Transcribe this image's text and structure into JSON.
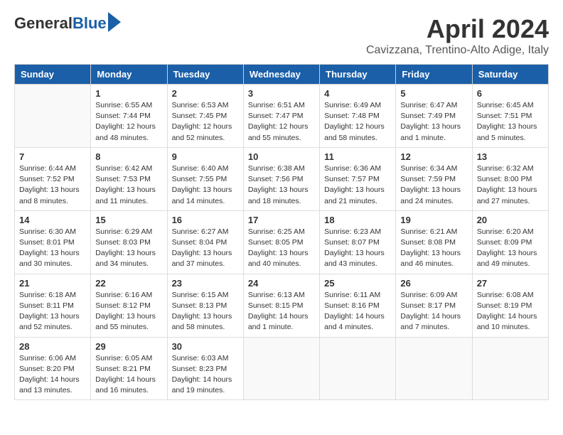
{
  "header": {
    "logo_general": "General",
    "logo_blue": "Blue",
    "title": "April 2024",
    "subtitle": "Cavizzana, Trentino-Alto Adige, Italy"
  },
  "weekdays": [
    "Sunday",
    "Monday",
    "Tuesday",
    "Wednesday",
    "Thursday",
    "Friday",
    "Saturday"
  ],
  "weeks": [
    [
      {
        "day": "",
        "info": ""
      },
      {
        "day": "1",
        "info": "Sunrise: 6:55 AM\nSunset: 7:44 PM\nDaylight: 12 hours\nand 48 minutes."
      },
      {
        "day": "2",
        "info": "Sunrise: 6:53 AM\nSunset: 7:45 PM\nDaylight: 12 hours\nand 52 minutes."
      },
      {
        "day": "3",
        "info": "Sunrise: 6:51 AM\nSunset: 7:47 PM\nDaylight: 12 hours\nand 55 minutes."
      },
      {
        "day": "4",
        "info": "Sunrise: 6:49 AM\nSunset: 7:48 PM\nDaylight: 12 hours\nand 58 minutes."
      },
      {
        "day": "5",
        "info": "Sunrise: 6:47 AM\nSunset: 7:49 PM\nDaylight: 13 hours\nand 1 minute."
      },
      {
        "day": "6",
        "info": "Sunrise: 6:45 AM\nSunset: 7:51 PM\nDaylight: 13 hours\nand 5 minutes."
      }
    ],
    [
      {
        "day": "7",
        "info": "Sunrise: 6:44 AM\nSunset: 7:52 PM\nDaylight: 13 hours\nand 8 minutes."
      },
      {
        "day": "8",
        "info": "Sunrise: 6:42 AM\nSunset: 7:53 PM\nDaylight: 13 hours\nand 11 minutes."
      },
      {
        "day": "9",
        "info": "Sunrise: 6:40 AM\nSunset: 7:55 PM\nDaylight: 13 hours\nand 14 minutes."
      },
      {
        "day": "10",
        "info": "Sunrise: 6:38 AM\nSunset: 7:56 PM\nDaylight: 13 hours\nand 18 minutes."
      },
      {
        "day": "11",
        "info": "Sunrise: 6:36 AM\nSunset: 7:57 PM\nDaylight: 13 hours\nand 21 minutes."
      },
      {
        "day": "12",
        "info": "Sunrise: 6:34 AM\nSunset: 7:59 PM\nDaylight: 13 hours\nand 24 minutes."
      },
      {
        "day": "13",
        "info": "Sunrise: 6:32 AM\nSunset: 8:00 PM\nDaylight: 13 hours\nand 27 minutes."
      }
    ],
    [
      {
        "day": "14",
        "info": "Sunrise: 6:30 AM\nSunset: 8:01 PM\nDaylight: 13 hours\nand 30 minutes."
      },
      {
        "day": "15",
        "info": "Sunrise: 6:29 AM\nSunset: 8:03 PM\nDaylight: 13 hours\nand 34 minutes."
      },
      {
        "day": "16",
        "info": "Sunrise: 6:27 AM\nSunset: 8:04 PM\nDaylight: 13 hours\nand 37 minutes."
      },
      {
        "day": "17",
        "info": "Sunrise: 6:25 AM\nSunset: 8:05 PM\nDaylight: 13 hours\nand 40 minutes."
      },
      {
        "day": "18",
        "info": "Sunrise: 6:23 AM\nSunset: 8:07 PM\nDaylight: 13 hours\nand 43 minutes."
      },
      {
        "day": "19",
        "info": "Sunrise: 6:21 AM\nSunset: 8:08 PM\nDaylight: 13 hours\nand 46 minutes."
      },
      {
        "day": "20",
        "info": "Sunrise: 6:20 AM\nSunset: 8:09 PM\nDaylight: 13 hours\nand 49 minutes."
      }
    ],
    [
      {
        "day": "21",
        "info": "Sunrise: 6:18 AM\nSunset: 8:11 PM\nDaylight: 13 hours\nand 52 minutes."
      },
      {
        "day": "22",
        "info": "Sunrise: 6:16 AM\nSunset: 8:12 PM\nDaylight: 13 hours\nand 55 minutes."
      },
      {
        "day": "23",
        "info": "Sunrise: 6:15 AM\nSunset: 8:13 PM\nDaylight: 13 hours\nand 58 minutes."
      },
      {
        "day": "24",
        "info": "Sunrise: 6:13 AM\nSunset: 8:15 PM\nDaylight: 14 hours\nand 1 minute."
      },
      {
        "day": "25",
        "info": "Sunrise: 6:11 AM\nSunset: 8:16 PM\nDaylight: 14 hours\nand 4 minutes."
      },
      {
        "day": "26",
        "info": "Sunrise: 6:09 AM\nSunset: 8:17 PM\nDaylight: 14 hours\nand 7 minutes."
      },
      {
        "day": "27",
        "info": "Sunrise: 6:08 AM\nSunset: 8:19 PM\nDaylight: 14 hours\nand 10 minutes."
      }
    ],
    [
      {
        "day": "28",
        "info": "Sunrise: 6:06 AM\nSunset: 8:20 PM\nDaylight: 14 hours\nand 13 minutes."
      },
      {
        "day": "29",
        "info": "Sunrise: 6:05 AM\nSunset: 8:21 PM\nDaylight: 14 hours\nand 16 minutes."
      },
      {
        "day": "30",
        "info": "Sunrise: 6:03 AM\nSunset: 8:23 PM\nDaylight: 14 hours\nand 19 minutes."
      },
      {
        "day": "",
        "info": ""
      },
      {
        "day": "",
        "info": ""
      },
      {
        "day": "",
        "info": ""
      },
      {
        "day": "",
        "info": ""
      }
    ]
  ]
}
